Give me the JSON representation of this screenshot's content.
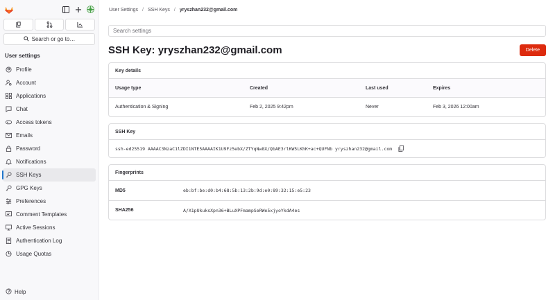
{
  "sidebar": {
    "seg_icons": [
      "merge-requests-icon",
      "issues-icon",
      "todo-icon"
    ],
    "search_label": "Search or go to…",
    "heading": "User settings",
    "items": [
      {
        "label": "Profile",
        "icon": "profile-icon"
      },
      {
        "label": "Account",
        "icon": "account-icon"
      },
      {
        "label": "Applications",
        "icon": "applications-icon"
      },
      {
        "label": "Chat",
        "icon": "chat-icon"
      },
      {
        "label": "Access tokens",
        "icon": "token-icon"
      },
      {
        "label": "Emails",
        "icon": "mail-icon"
      },
      {
        "label": "Password",
        "icon": "lock-icon"
      },
      {
        "label": "Notifications",
        "icon": "bell-icon"
      },
      {
        "label": "SSH Keys",
        "icon": "key-icon",
        "active": true
      },
      {
        "label": "GPG Keys",
        "icon": "key-icon"
      },
      {
        "label": "Preferences",
        "icon": "preferences-icon"
      },
      {
        "label": "Comment Templates",
        "icon": "comment-icon"
      },
      {
        "label": "Active Sessions",
        "icon": "monitor-icon"
      },
      {
        "label": "Authentication Log",
        "icon": "log-icon"
      },
      {
        "label": "Usage Quotas",
        "icon": "quota-icon"
      }
    ],
    "help": "Help"
  },
  "breadcrumb": {
    "items": [
      "User Settings",
      "SSH Keys"
    ],
    "current": "yryszhan232@gmail.com"
  },
  "search": {
    "placeholder": "Search settings"
  },
  "page": {
    "title": "SSH Key: yryszhan232@gmail.com",
    "delete_label": "Delete"
  },
  "key_details": {
    "heading": "Key details",
    "columns": [
      "Usage type",
      "Created",
      "Last used",
      "Expires"
    ],
    "row": [
      "Authentication & Signing",
      "Feb 2, 2025 9:42pm",
      "Never",
      "Feb 3, 2026 12:00am"
    ]
  },
  "ssh_key": {
    "heading": "SSH Key",
    "value": "ssh-ed25519 AAAAC3NzaC1lZDI1NTE5AAAAIK1U9Fz5ebX/ZTYqNw8X/QbAE3rlKW5LKhK+ac+QUFNb yryszhan232@gmail.com"
  },
  "fingerprints": {
    "heading": "Fingerprints",
    "rows": [
      {
        "label": "MD5",
        "value": "eb:bf:be:d0:b4:68:5b:13:2b:9d:e0:89:32:15:e5:23"
      },
      {
        "label": "SHA256",
        "value": "A/X1pUkuksXpn36+BLuXPFmampSeRWe5xjyoYkdA4es"
      }
    ]
  },
  "colors": {
    "accent": "#1f75cb",
    "danger": "#dd2b0e",
    "logo": "#e24329"
  }
}
